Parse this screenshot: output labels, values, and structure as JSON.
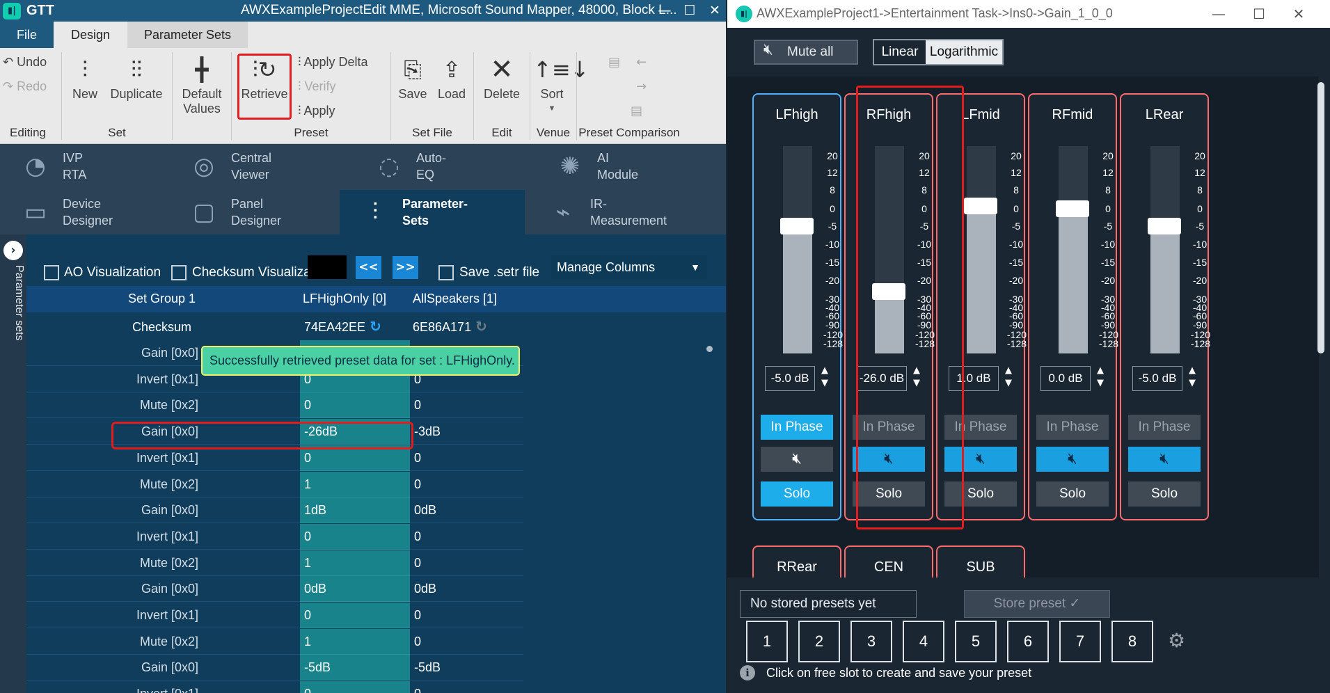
{
  "left_window": {
    "app_name": "GTT",
    "title": "AWXExampleProjectEdit MME, Microsoft Sound Mapper, 48000, Block L...",
    "controls": {
      "minimize": "—",
      "maximize": "☐",
      "close": "✕"
    },
    "menu_tabs": [
      "File",
      "Design",
      "Parameter Sets"
    ],
    "ribbon": {
      "undo": "Undo",
      "redo": "Redo",
      "new": "New",
      "duplicate": "Duplicate",
      "default_values": "Default Values",
      "retrieve": "Retrieve",
      "apply_delta": "Apply Delta",
      "verify": "Verify",
      "apply": "Apply",
      "save": "Save",
      "load": "Load",
      "delete": "Delete",
      "sort": "Sort",
      "groups": [
        "Editing",
        "Set",
        "Preset",
        "Set File",
        "Edit",
        "Venue",
        "Preset Comparison"
      ]
    },
    "tools": [
      {
        "line1": "IVP",
        "line2": "RTA",
        "icon": "rta-icon"
      },
      {
        "line1": "Central",
        "line2": "Viewer",
        "icon": "viewer-icon"
      },
      {
        "line1": "Auto-",
        "line2": "EQ",
        "icon": "eq-icon"
      },
      {
        "line1": "AI",
        "line2": "Module",
        "icon": "ai-icon"
      },
      {
        "line1": "Device",
        "line2": "Designer",
        "icon": "device-icon"
      },
      {
        "line1": "Panel",
        "line2": "Designer",
        "icon": "panel-icon"
      },
      {
        "line1": "Parameter-",
        "line2": "Sets",
        "icon": "sliders-icon"
      },
      {
        "line1": "IR-",
        "line2": "Measurement",
        "icon": "ir-icon"
      }
    ],
    "sidebar_label": "Parameter sets",
    "options": {
      "ao_visualization": "AO Visualization",
      "checksum_visualization": "Checksum Visualizat",
      "prev": "<<",
      "next": ">>",
      "save_setr": "Save .setr file",
      "manage_columns": "Manage Columns"
    },
    "table": {
      "set_group": "Set Group 1",
      "col_a": "LFHighOnly [0]",
      "col_b": "AllSpeakers [1]",
      "checksum_label": "Checksum",
      "checksum_a": "74EA42EE",
      "checksum_b": "6E86A171",
      "rows": [
        {
          "name": "Gain [0x0]",
          "a": "",
          "b": ""
        },
        {
          "name": "Invert [0x1]",
          "a": "0",
          "b": "0"
        },
        {
          "name": "Mute [0x2]",
          "a": "0",
          "b": "0"
        },
        {
          "name": "Gain [0x0]",
          "a": "-26dB",
          "b": "-3dB"
        },
        {
          "name": "Invert [0x1]",
          "a": "0",
          "b": "0"
        },
        {
          "name": "Mute [0x2]",
          "a": "1",
          "b": "0"
        },
        {
          "name": "Gain [0x0]",
          "a": "1dB",
          "b": "0dB"
        },
        {
          "name": "Invert [0x1]",
          "a": "0",
          "b": "0"
        },
        {
          "name": "Mute [0x2]",
          "a": "1",
          "b": "0"
        },
        {
          "name": "Gain [0x0]",
          "a": "0dB",
          "b": "0dB"
        },
        {
          "name": "Invert [0x1]",
          "a": "0",
          "b": "0"
        },
        {
          "name": "Mute [0x2]",
          "a": "1",
          "b": "0"
        },
        {
          "name": "Gain [0x0]",
          "a": "-5dB",
          "b": "-5dB"
        },
        {
          "name": "Invert [0x1]",
          "a": "0",
          "b": "0"
        }
      ]
    },
    "toast": "Successfully retrieved preset data for set :  LFHighOnly."
  },
  "right_window": {
    "title": "AWXExampleProject1->Entertainment Task->Ins0->Gain_1_0_0",
    "controls": {
      "minimize": "—",
      "maximize": "☐",
      "close": "✕"
    },
    "mute_all": "Mute all",
    "scale_linear": "Linear",
    "scale_logarithmic": "Logarithmic",
    "scale_labels": [
      "20",
      "12",
      "8",
      "0",
      "-5",
      "-10",
      "-15",
      "-20",
      "-30",
      "-40",
      "-60",
      "-90",
      "-120",
      "-128"
    ],
    "channels": [
      {
        "name": "LFhigh",
        "gain_db": "-5.0 dB",
        "level_db": -5,
        "phase": "In Phase",
        "solo": "Solo",
        "phase_on": true,
        "mute_on": false,
        "solo_on": true,
        "border": "#4fb0ff"
      },
      {
        "name": "RFhigh",
        "gain_db": "-26.0 dB",
        "level_db": -26,
        "phase": "In Phase",
        "solo": "Solo",
        "phase_on": false,
        "mute_on": true,
        "solo_on": false,
        "border": "#ff6b6b"
      },
      {
        "name": "LFmid",
        "gain_db": "1.0 dB",
        "level_db": 1,
        "phase": "In Phase",
        "solo": "Solo",
        "phase_on": false,
        "mute_on": true,
        "solo_on": false,
        "border": "#ff6b6b"
      },
      {
        "name": "RFmid",
        "gain_db": "0.0 dB",
        "level_db": 0,
        "phase": "In Phase",
        "solo": "Solo",
        "phase_on": false,
        "mute_on": true,
        "solo_on": false,
        "border": "#ff6b6b"
      },
      {
        "name": "LRear",
        "gain_db": "-5.0 dB",
        "level_db": -5,
        "phase": "In Phase",
        "solo": "Solo",
        "phase_on": false,
        "mute_on": true,
        "solo_on": false,
        "border": "#ff6b6b"
      }
    ],
    "channels_row2": [
      "RRear",
      "CEN",
      "SUB"
    ],
    "preset_name": "No stored presets yet",
    "store_preset": "Store preset ✓",
    "slots": [
      "1",
      "2",
      "3",
      "4",
      "5",
      "6",
      "7",
      "8"
    ],
    "info": "Click on free slot to create and save your preset"
  }
}
